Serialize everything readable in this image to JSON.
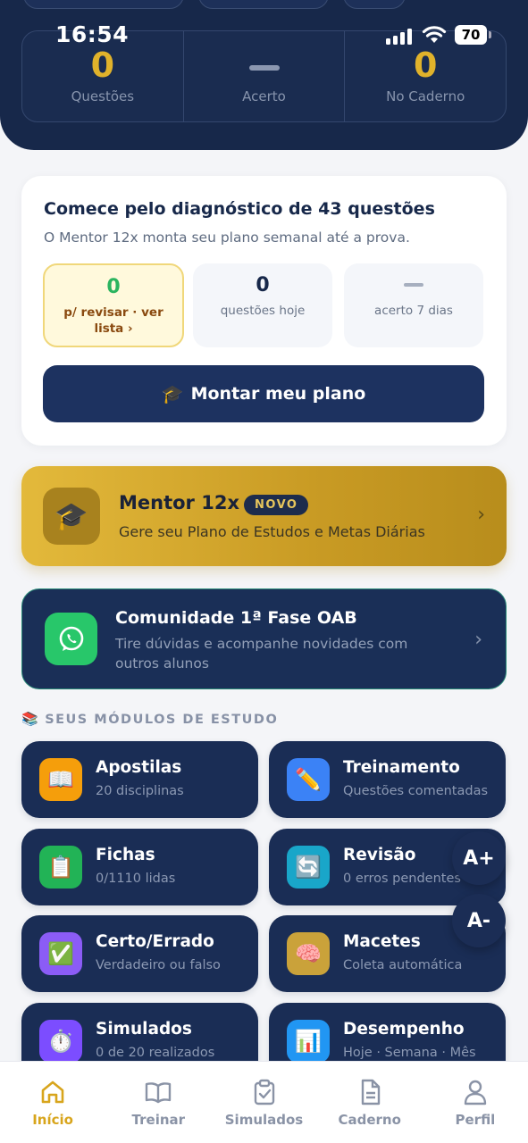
{
  "status_bar": {
    "time": "16:54",
    "battery": "70"
  },
  "header": {
    "stats": [
      {
        "value": "0",
        "label": "Questões"
      },
      {
        "value": "",
        "label": "Acerto"
      },
      {
        "value": "0",
        "label": "No Caderno"
      }
    ]
  },
  "diagnostic": {
    "title": "Comece pelo diagnóstico de 43 questões",
    "subtitle": "O Mentor 12x monta seu plano semanal até a prova.",
    "stats": [
      {
        "value": "0",
        "label": "p/ revisar · ver lista ›"
      },
      {
        "value": "0",
        "label": "questões hoje"
      },
      {
        "value": "",
        "label": "acerto 7 dias"
      }
    ],
    "button_icon": "graduation-cap-icon",
    "button_label": "Montar meu plano"
  },
  "mentor": {
    "title": "Mentor 12x",
    "badge": "NOVO",
    "subtitle": "Gere seu Plano de Estudos e Metas Diárias"
  },
  "community": {
    "title": "Comunidade 1ª Fase OAB",
    "subtitle": "Tire dúvidas e acompanhe novidades com outros alunos"
  },
  "modules": {
    "section_title": "SEUS MÓDULOS DE ESTUDO",
    "items": [
      {
        "title": "Apostilas",
        "subtitle": "20 disciplinas",
        "icon": "book-icon",
        "color": "#f59e0b"
      },
      {
        "title": "Treinamento",
        "subtitle": "Questões comentadas",
        "icon": "pencil-icon",
        "color": "#3b82f6"
      },
      {
        "title": "Fichas",
        "subtitle": "0/1110 lidas",
        "icon": "clipboard-icon",
        "color": "#22b356"
      },
      {
        "title": "Revisão",
        "subtitle": "0 erros pendentes",
        "icon": "refresh-icon",
        "color": "#19a6c9"
      },
      {
        "title": "Certo/Errado",
        "subtitle": "Verdadeiro ou falso",
        "icon": "checkbox-icon",
        "color": "#8b5cf6"
      },
      {
        "title": "Macetes",
        "subtitle": "Coleta automática",
        "icon": "brain-icon",
        "color": "#caa23a"
      },
      {
        "title": "Simulados",
        "subtitle": "0 de 20 realizados",
        "icon": "stopwatch-icon",
        "color": "#7c4dff"
      },
      {
        "title": "Desempenho",
        "subtitle": "Hoje · Semana · Mês",
        "icon": "bar-chart-icon",
        "color": "#2196f3"
      }
    ]
  },
  "font_controls": {
    "increase": "A+",
    "decrease": "A-"
  },
  "bottom_nav": {
    "items": [
      {
        "label": "Início",
        "icon": "home-icon",
        "active": true
      },
      {
        "label": "Treinar",
        "icon": "open-book-icon",
        "active": false
      },
      {
        "label": "Simulados",
        "icon": "clipboard-check-icon",
        "active": false
      },
      {
        "label": "Caderno",
        "icon": "document-icon",
        "active": false
      },
      {
        "label": "Perfil",
        "icon": "user-icon",
        "active": false
      }
    ],
    "active_color": "#d8a51c"
  }
}
